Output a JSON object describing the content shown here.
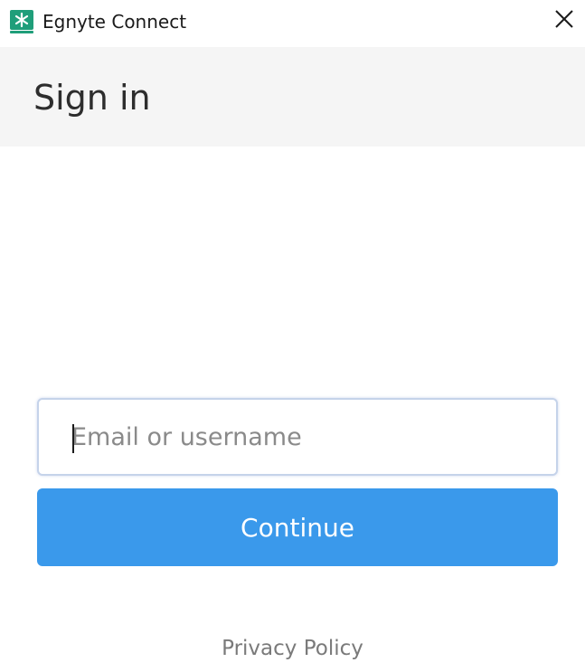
{
  "window": {
    "title": "Egnyte Connect",
    "app_icon": "egnyte-logo-icon",
    "close_icon": "close-icon"
  },
  "header": {
    "title": "Sign in"
  },
  "form": {
    "email_placeholder": "Email or username",
    "email_value": "",
    "continue_label": "Continue"
  },
  "footer": {
    "privacy_label": "Privacy Policy"
  },
  "colors": {
    "brand_green": "#1f9e7a",
    "primary_button": "#3a99eb",
    "header_background": "#f5f5f5"
  }
}
